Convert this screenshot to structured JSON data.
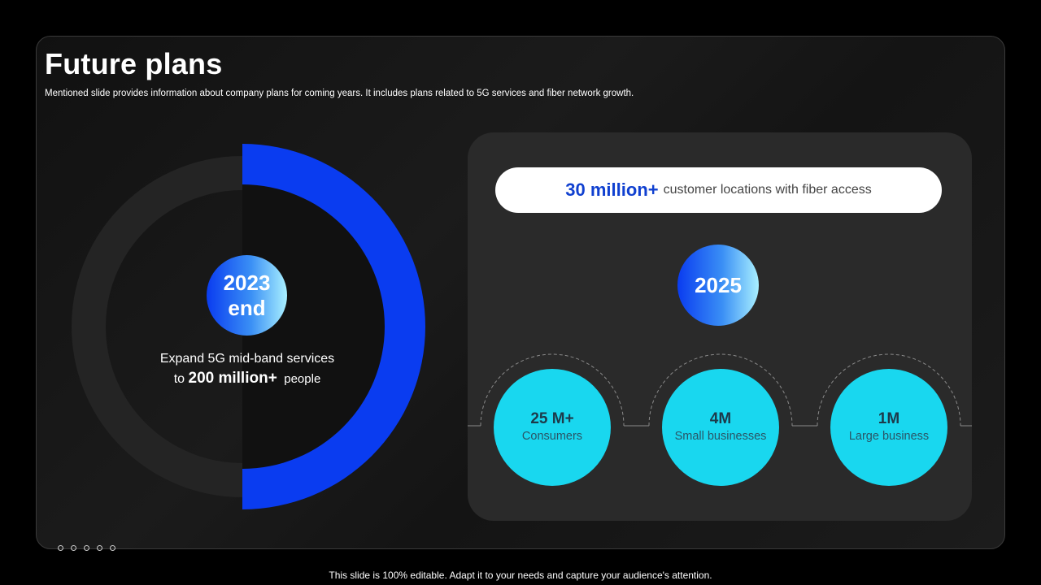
{
  "slide": {
    "title": "Future plans",
    "subtitle": "Mentioned slide provides information about company plans for coming years. It includes plans related to 5G services and fiber network growth."
  },
  "left": {
    "badge_line1": "2023",
    "badge_line2": "end",
    "text_line1": "Expand 5G mid-band services",
    "text_prefix": "to",
    "text_highlight": "200 million+",
    "text_suffix": "people",
    "progress_fraction": 0.5,
    "colors": {
      "progress": "#0a3cf0",
      "track": "#242424"
    }
  },
  "right": {
    "pill_highlight": "30 million+",
    "pill_text": "customer locations with fiber access",
    "badge": "2025",
    "stats": [
      {
        "value": "25 M+",
        "label": "Consumers"
      },
      {
        "value": "4M",
        "label": "Small businesses"
      },
      {
        "value": "1M",
        "label": "Large business"
      }
    ],
    "colors": {
      "stat": "#19d7ef",
      "highlight": "#1040d0"
    }
  },
  "footer": "This slide is 100% editable. Adapt it to your needs and capture your audience's attention."
}
